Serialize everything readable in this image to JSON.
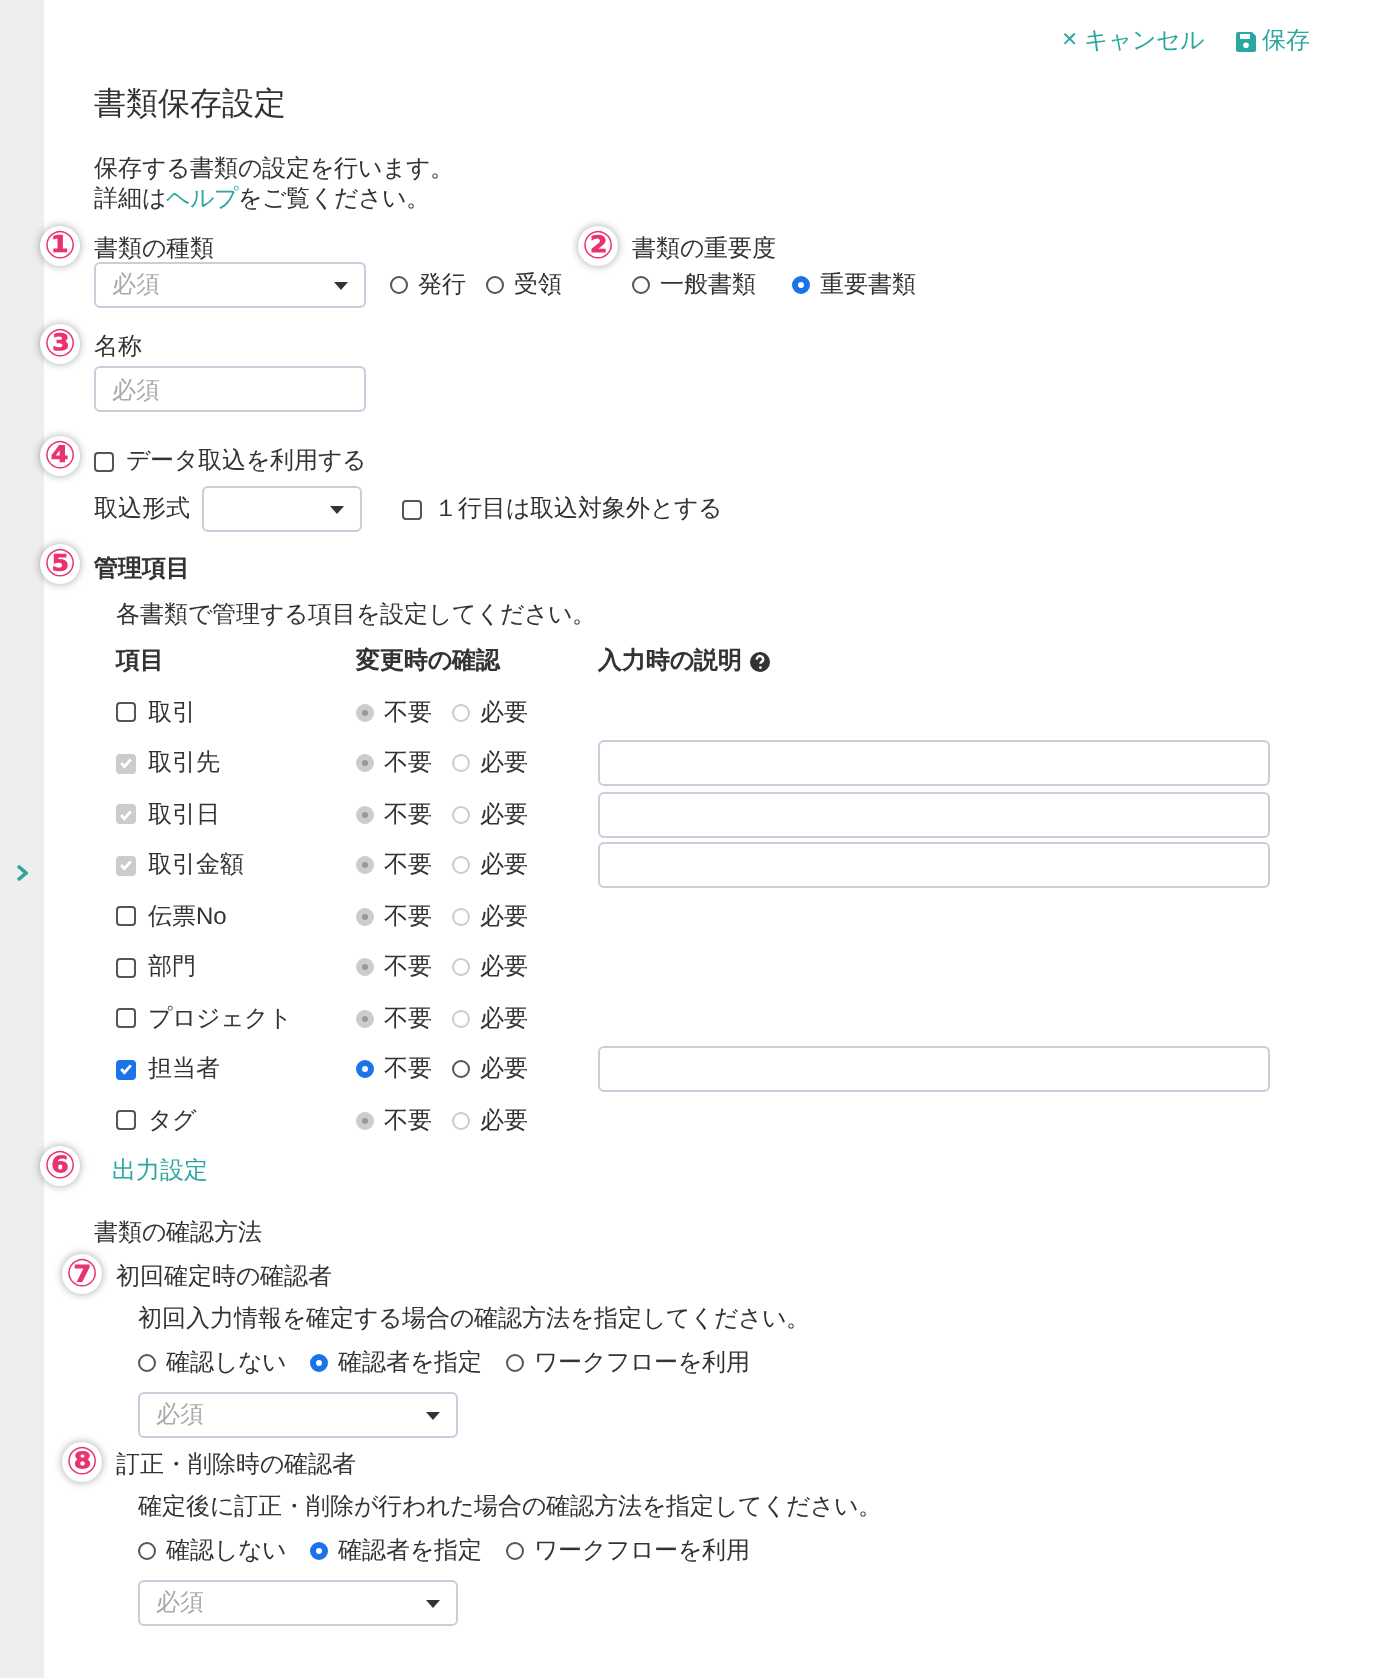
{
  "toolbar": {
    "cancel": {
      "icon": "✕",
      "label": "キャンセル"
    },
    "save": {
      "label": "保存"
    }
  },
  "title": "書類保存設定",
  "intro": {
    "line_1": "保存する書類の設定を行います。",
    "line_2": {
      "before": "詳細は",
      "link": "ヘルプ",
      "after": "をご覧ください。"
    }
  },
  "document_type": {
    "marker": "①",
    "label": "書類の種類",
    "select": {
      "placeholder": "必須"
    },
    "options": [
      {
        "label": "発行",
        "selected": false
      },
      {
        "label": "受領",
        "selected": false
      }
    ]
  },
  "importance": {
    "marker": "②",
    "label": "書類の重要度",
    "options": [
      {
        "label": "一般書類",
        "selected": false
      },
      {
        "label": "重要書類",
        "selected": true
      }
    ]
  },
  "name": {
    "marker": "③",
    "label": "名称",
    "placeholder": "必須"
  },
  "data_import": {
    "marker": "④",
    "checkbox": {
      "label": "データ取込を利用する",
      "checked": false
    },
    "format_label": "取込形式",
    "skip_first_row": {
      "label": "１行目は取込対象外とする",
      "checked": false
    }
  },
  "managed_items": {
    "marker": "⑤",
    "title": "管理項目",
    "description": "各書類で管理する項目を設定してください。",
    "columns": [
      "項目",
      "変更時の確認",
      "入力時の説明"
    ],
    "rows": [
      {
        "label": "取引",
        "checked": false,
        "disabled": false,
        "options_disabled": true,
        "options": [
          {
            "label": "不要",
            "selected": true
          },
          {
            "label": "必要",
            "selected": false
          }
        ],
        "description_field": false
      },
      {
        "label": "取引先",
        "checked": true,
        "disabled": true,
        "options_disabled": true,
        "options": [
          {
            "label": "不要",
            "selected": true
          },
          {
            "label": "必要",
            "selected": false
          }
        ],
        "description_field": true
      },
      {
        "label": "取引日",
        "checked": true,
        "disabled": true,
        "options_disabled": true,
        "options": [
          {
            "label": "不要",
            "selected": true
          },
          {
            "label": "必要",
            "selected": false
          }
        ],
        "description_field": true
      },
      {
        "label": "取引金額",
        "checked": true,
        "disabled": true,
        "options_disabled": true,
        "options": [
          {
            "label": "不要",
            "selected": true
          },
          {
            "label": "必要",
            "selected": false
          }
        ],
        "description_field": true
      },
      {
        "label": "伝票No",
        "checked": false,
        "disabled": false,
        "options_disabled": true,
        "options": [
          {
            "label": "不要",
            "selected": true
          },
          {
            "label": "必要",
            "selected": false
          }
        ],
        "description_field": false
      },
      {
        "label": "部門",
        "checked": false,
        "disabled": false,
        "options_disabled": true,
        "options": [
          {
            "label": "不要",
            "selected": true
          },
          {
            "label": "必要",
            "selected": false
          }
        ],
        "description_field": false
      },
      {
        "label": "プロジェクト",
        "checked": false,
        "disabled": false,
        "options_disabled": true,
        "options": [
          {
            "label": "不要",
            "selected": true
          },
          {
            "label": "必要",
            "selected": false
          }
        ],
        "description_field": false
      },
      {
        "label": "担当者",
        "checked": true,
        "disabled": false,
        "options_disabled": false,
        "options": [
          {
            "label": "不要",
            "selected": true
          },
          {
            "label": "必要",
            "selected": false
          }
        ],
        "description_field": true
      },
      {
        "label": "タグ",
        "checked": false,
        "disabled": false,
        "options_disabled": true,
        "options": [
          {
            "label": "不要",
            "selected": true
          },
          {
            "label": "必要",
            "selected": false
          }
        ],
        "description_field": false
      }
    ]
  },
  "output_settings": {
    "marker": "⑥",
    "link": "出力設定"
  },
  "confirmation": {
    "title": "書類の確認方法",
    "sections": [
      {
        "marker": "⑦",
        "title": "初回確定時の確認者",
        "description": "初回入力情報を確定する場合の確認方法を指定してください。",
        "options": [
          {
            "label": "確認しない",
            "selected": false
          },
          {
            "label": "確認者を指定",
            "selected": true
          },
          {
            "label": "ワークフローを利用",
            "selected": false
          }
        ],
        "select": {
          "placeholder": "必須"
        }
      },
      {
        "marker": "⑧",
        "title": "訂正・削除時の確認者",
        "description": "確定後に訂正・削除が行われた場合の確認方法を指定してください。",
        "options": [
          {
            "label": "確認しない",
            "selected": false
          },
          {
            "label": "確認者を指定",
            "selected": true
          },
          {
            "label": "ワークフローを利用",
            "selected": false
          }
        ],
        "select": {
          "placeholder": "必須"
        }
      }
    ]
  }
}
